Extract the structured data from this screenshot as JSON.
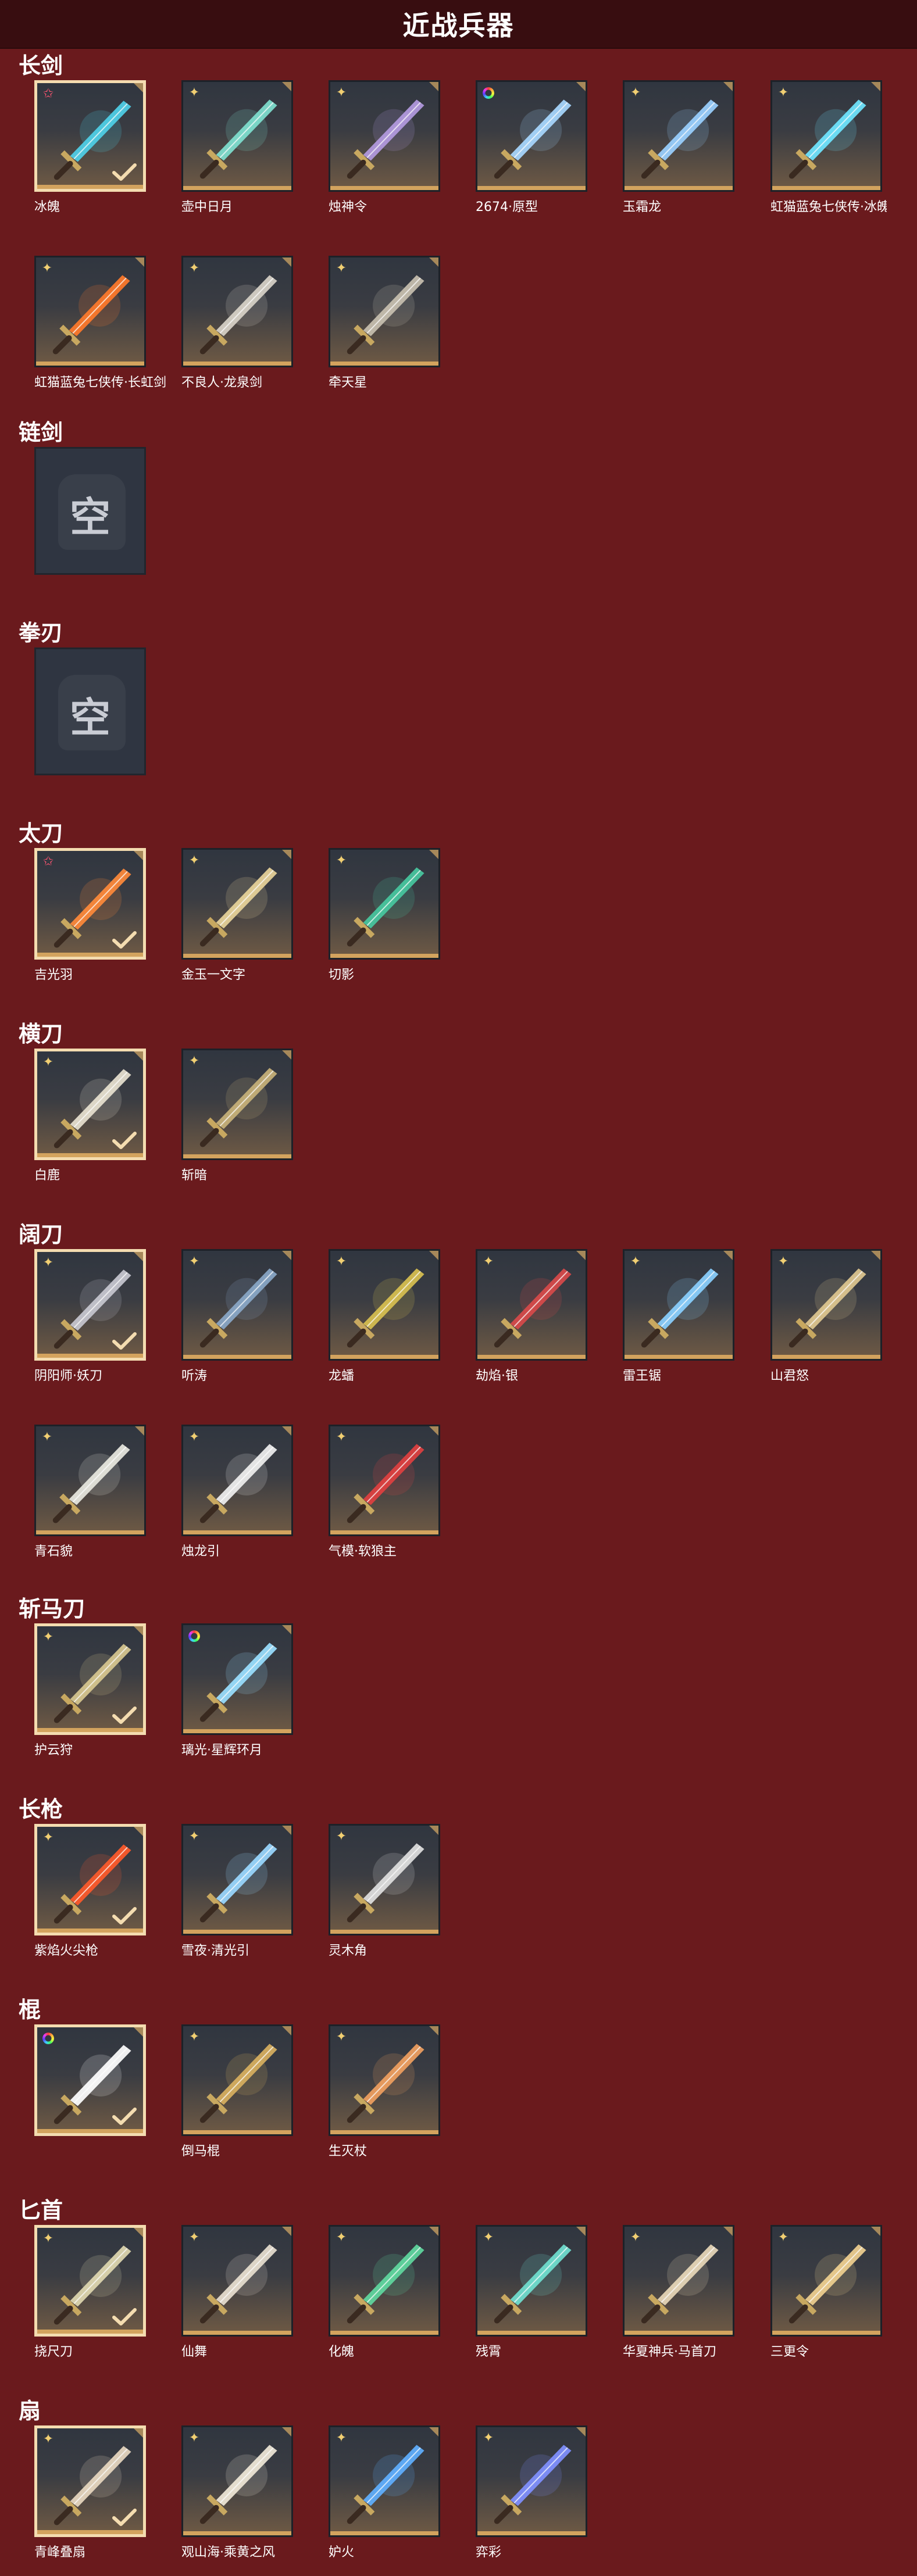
{
  "page": {
    "title": "近战兵器"
  },
  "sections": [
    {
      "title": "长剑",
      "items": [
        {
          "name": "冰魄",
          "badge": "star",
          "selected": true,
          "color": "#4fd0e8"
        },
        {
          "name": "壶中日月",
          "badge": "cross",
          "selected": false,
          "color": "#7fe0cf"
        },
        {
          "name": "烛神令",
          "badge": "cross",
          "selected": false,
          "color": "#b39ae0"
        },
        {
          "name": "2674·原型",
          "badge": "rainbow",
          "selected": false,
          "color": "#a8d8ff"
        },
        {
          "name": "玉霜龙",
          "badge": "cross",
          "selected": false,
          "color": "#9ad0ff"
        },
        {
          "name": "虹猫蓝兔七侠传·冰魄剑",
          "badge": "cross",
          "selected": false,
          "color": "#6fe6ff"
        },
        {
          "name": "虹猫蓝兔七侠传·长虹剑",
          "badge": "cross",
          "selected": false,
          "color": "#ff7a2a"
        },
        {
          "name": "不良人·龙泉剑",
          "badge": "cross",
          "selected": false,
          "color": "#d8d2c8"
        },
        {
          "name": "牵天星",
          "badge": "cross",
          "selected": false,
          "color": "#c8c0b0"
        }
      ]
    },
    {
      "title": "链剑",
      "empty": "空"
    },
    {
      "title": "拳刃",
      "empty": "空"
    },
    {
      "title": "太刀",
      "items": [
        {
          "name": "吉光羽",
          "badge": "star",
          "selected": true,
          "color": "#ff8a3a"
        },
        {
          "name": "金玉一文字",
          "badge": "cross",
          "selected": false,
          "color": "#e8d49a"
        },
        {
          "name": "切影",
          "badge": "cross",
          "selected": false,
          "color": "#48c8a0"
        }
      ]
    },
    {
      "title": "横刀",
      "items": [
        {
          "name": "白鹿",
          "badge": "cross",
          "selected": true,
          "color": "#e8e2d0"
        },
        {
          "name": "斩暗",
          "badge": "cross",
          "selected": false,
          "color": "#c8b27a"
        }
      ]
    },
    {
      "title": "阔刀",
      "items": [
        {
          "name": "阴阳师·妖刀",
          "badge": "cross",
          "selected": true,
          "color": "#c8c8d0"
        },
        {
          "name": "听涛",
          "badge": "cross",
          "selected": false,
          "color": "#8aa8c8"
        },
        {
          "name": "龙蟠",
          "badge": "cross",
          "selected": false,
          "color": "#d8c050"
        },
        {
          "name": "劫焰·银",
          "badge": "cross",
          "selected": false,
          "color": "#d84a4a"
        },
        {
          "name": "雷王锯",
          "badge": "cross",
          "selected": false,
          "color": "#8ad0ff"
        },
        {
          "name": "山君怒",
          "badge": "cross",
          "selected": false,
          "color": "#e0c890"
        },
        {
          "name": "青石貌",
          "badge": "cross",
          "selected": false,
          "color": "#e8e8e0"
        },
        {
          "name": "烛龙引",
          "badge": "cross",
          "selected": false,
          "color": "#f0f0f0"
        },
        {
          "name": "气模·软狼主",
          "badge": "cross",
          "selected": false,
          "color": "#e04040"
        }
      ]
    },
    {
      "title": "斩马刀",
      "items": [
        {
          "name": "护云狩",
          "badge": "cross",
          "selected": true,
          "color": "#d8c890"
        },
        {
          "name": "璃光·星辉环月",
          "badge": "rainbow",
          "selected": false,
          "color": "#9ae0ff"
        }
      ]
    },
    {
      "title": "长枪",
      "items": [
        {
          "name": "紫焰火尖枪",
          "badge": "cross",
          "selected": true,
          "color": "#ff5a2a"
        },
        {
          "name": "雪夜·清光引",
          "badge": "cross",
          "selected": false,
          "color": "#9ad8ff"
        },
        {
          "name": "灵木角",
          "badge": "cross",
          "selected": false,
          "color": "#e0e0e0"
        }
      ]
    },
    {
      "title": "棍",
      "items": [
        {
          "name": "",
          "badge": "rainbow",
          "selected": true,
          "color": "#ffffff"
        },
        {
          "name": "倒马棍",
          "badge": "cross",
          "selected": false,
          "color": "#d8b060"
        },
        {
          "name": "生灭杖",
          "badge": "cross",
          "selected": false,
          "color": "#f0a060"
        }
      ]
    },
    {
      "title": "匕首",
      "items": [
        {
          "name": "挠尺刀",
          "badge": "cross",
          "selected": true,
          "color": "#e0d8b0"
        },
        {
          "name": "仙舞",
          "badge": "cross",
          "selected": false,
          "color": "#e8e0d0"
        },
        {
          "name": "化魄",
          "badge": "cross",
          "selected": false,
          "color": "#60d8a0"
        },
        {
          "name": "残霄",
          "badge": "cross",
          "selected": false,
          "color": "#70e0d0"
        },
        {
          "name": "华夏神兵·马首刀",
          "badge": "cross",
          "selected": false,
          "color": "#e8d8b8"
        },
        {
          "name": "三更令",
          "badge": "cross",
          "selected": false,
          "color": "#f0d090"
        }
      ]
    },
    {
      "title": "扇",
      "items": [
        {
          "name": "青峰叠扇",
          "badge": "cross",
          "selected": true,
          "color": "#e8d8c0"
        },
        {
          "name": "观山海·乘黄之风",
          "badge": "cross",
          "selected": false,
          "color": "#f0e8d8"
        },
        {
          "name": "妒火",
          "badge": "cross",
          "selected": false,
          "color": "#60b0ff"
        },
        {
          "name": "弈彩",
          "badge": "cross",
          "selected": false,
          "color": "#8090ff"
        }
      ]
    }
  ]
}
